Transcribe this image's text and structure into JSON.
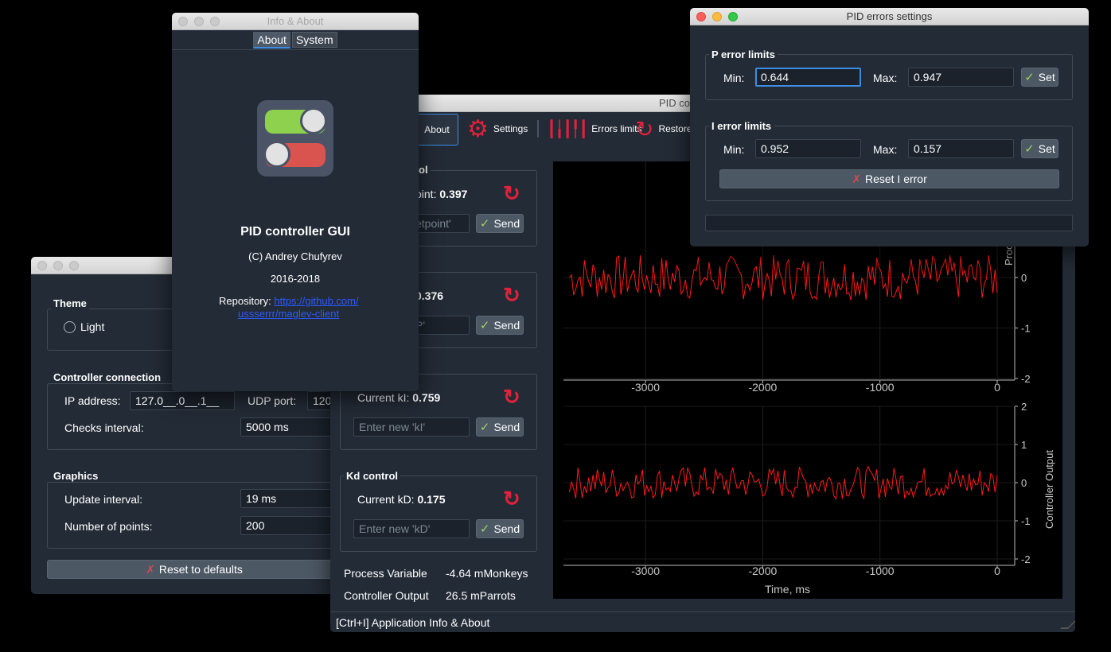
{
  "settings_window": {
    "theme": {
      "title": "Theme",
      "light_label": "Light"
    },
    "connection": {
      "title": "Controller connection",
      "ip_label": "IP address:",
      "ip_value": "127.0__.0__.1__",
      "udp_label": "UDP port:",
      "udp_value": "120",
      "checks_label": "Checks interval:",
      "checks_value": "5000 ms"
    },
    "graphics": {
      "title": "Graphics",
      "update_label": "Update interval:",
      "update_value": "19 ms",
      "points_label": "Number of points:",
      "points_value": "200"
    },
    "reset_label": "Reset to defaults"
  },
  "about_window": {
    "title": "Info & About",
    "tabs": [
      "About",
      "System"
    ],
    "app_name": "PID controller GUI",
    "copyright": "(C) Andrey Chufyrev",
    "years": "2016-2018",
    "repo_label": "Repository:",
    "repo_link_1": "https://github.com/",
    "repo_link_2": "ussserrr/maglev-client"
  },
  "main_window": {
    "title": "PID co",
    "toolbar": {
      "about": "About",
      "settings": "Settings",
      "errors": "Errors limits",
      "restore": "Restore"
    },
    "setpoint": {
      "title": "rol",
      "current_prefix": "oint:",
      "current_value": "0.397",
      "input_ph": "etpoint'",
      "send": "Send"
    },
    "kp": {
      "current_value": "0.376",
      "input_ph": "P'",
      "send": "Send"
    },
    "ki": {
      "current_prefix": "Current kI:",
      "current_value": "0.759",
      "input_ph": "Enter new 'kI'",
      "send": "Send"
    },
    "kd": {
      "title": "Kd control",
      "current_prefix": "Current kD:",
      "current_value": "0.175",
      "input_ph": "Enter new 'kD'",
      "send": "Send"
    },
    "pv_label": "Process Variable",
    "pv_value": "-4.64 mMonkeys",
    "co_label": "Controller Output",
    "co_value": "26.5 mParrots",
    "status": "[Ctrl+I] Application Info & About"
  },
  "errors_window": {
    "title": "PID errors settings",
    "p_title": "P error limits",
    "p_min_label": "Min:",
    "p_min": "0.644",
    "p_max_label": "Max:",
    "p_max": "0.947",
    "p_set": "Set",
    "i_title": "I error limits",
    "i_min_label": "Min:",
    "i_min": "0.952",
    "i_max_label": "Max:",
    "i_max": "0.157",
    "i_set": "Set",
    "reset_label": "Reset I error"
  },
  "plots": {
    "xticks": [
      "-3000",
      "-2000",
      "-1000",
      "0"
    ],
    "yticks_top": [
      "0",
      "-1",
      "-2"
    ],
    "yticks_bottom": [
      "2",
      "1",
      "0",
      "-1",
      "-2"
    ],
    "ylabel_top": "Process Variable",
    "ylabel_bottom": "Controller Output",
    "xlabel": "Time, ms",
    "line_color": "#ff1a1a"
  },
  "chart_data": [
    {
      "type": "line",
      "ylabel": "Process Variable",
      "xlabel": "",
      "xlim": [
        -3700,
        0
      ],
      "ylim": [
        -2,
        2
      ],
      "series": [
        {
          "name": "",
          "values_note": "noisy signal",
          "x": [
            -3700,
            0
          ],
          "y": [
            0,
            0
          ]
        }
      ]
    },
    {
      "type": "line",
      "ylabel": "Controller Output",
      "xlabel": "Time, ms",
      "xlim": [
        -3700,
        0
      ],
      "ylim": [
        -2,
        2
      ],
      "series": [
        {
          "name": "",
          "x": [
            -3700,
            0
          ],
          "y": [
            0,
            0
          ]
        }
      ]
    }
  ]
}
